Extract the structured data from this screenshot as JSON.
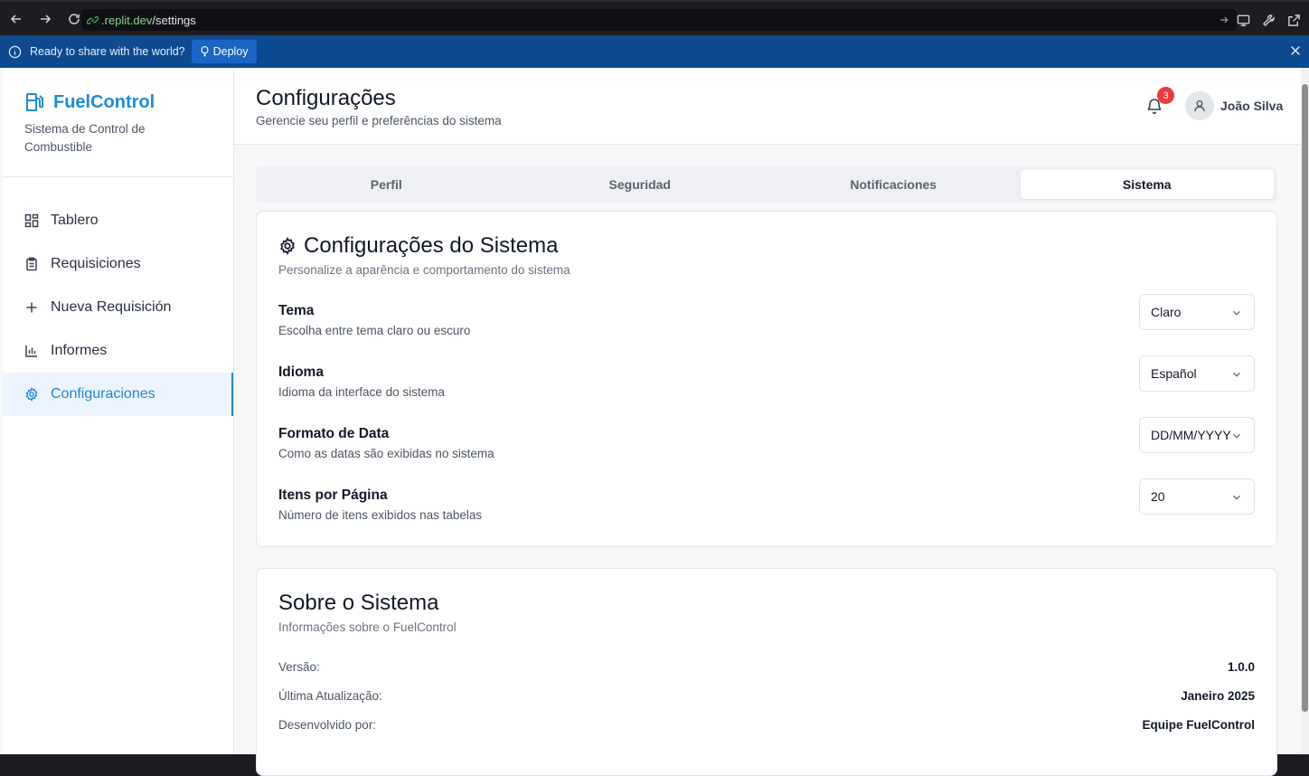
{
  "browser": {
    "url_host": ".replit.dev",
    "url_path": "/settings"
  },
  "banner": {
    "message": "Ready to share with the world?",
    "deploy_label": "Deploy"
  },
  "sidebar": {
    "brand_name": "FuelControl",
    "brand_subtitle": "Sistema de Control de Combustible",
    "items": [
      {
        "label": "Tablero",
        "icon": "dashboard-icon"
      },
      {
        "label": "Requisiciones",
        "icon": "clipboard-icon"
      },
      {
        "label": "Nueva Requisición",
        "icon": "plus-icon"
      },
      {
        "label": "Informes",
        "icon": "bar-chart-icon"
      },
      {
        "label": "Configuraciones",
        "icon": "gear-icon",
        "active": true
      }
    ]
  },
  "header": {
    "title": "Configurações",
    "subtitle": "Gerencie seu perfil e preferências do sistema",
    "notification_count": "3",
    "user_name": "João Silva"
  },
  "tabs": [
    {
      "label": "Perfil"
    },
    {
      "label": "Seguridad"
    },
    {
      "label": "Notificaciones"
    },
    {
      "label": "Sistema",
      "active": true
    }
  ],
  "system_settings": {
    "title": "Configurações do Sistema",
    "subtitle": "Personalize a aparência e comportamento do sistema",
    "settings": [
      {
        "label": "Tema",
        "description": "Escolha entre tema claro ou escuro",
        "value": "Claro"
      },
      {
        "label": "Idioma",
        "description": "Idioma da interface do sistema",
        "value": "Español"
      },
      {
        "label": "Formato de Data",
        "description": "Como as datas são exibidas no sistema",
        "value": "DD/MM/YYYY"
      },
      {
        "label": "Itens por Página",
        "description": "Número de itens exibidos nas tabelas",
        "value": "20"
      }
    ]
  },
  "about": {
    "title": "Sobre o Sistema",
    "subtitle": "Informações sobre o FuelControl",
    "rows": [
      {
        "label": "Versão:",
        "value": "1.0.0"
      },
      {
        "label": "Última Atualização:",
        "value": "Janeiro 2025"
      },
      {
        "label": "Desenvolvido por:",
        "value": "Equipe FuelControl"
      }
    ]
  },
  "colors": {
    "accent": "#2386d2",
    "banner": "#0d4a8f",
    "badge": "#ef3b3b"
  }
}
